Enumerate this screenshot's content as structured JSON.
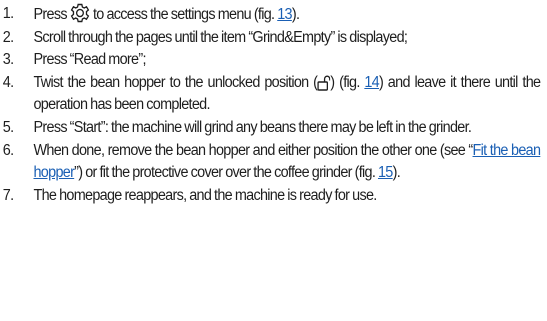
{
  "steps": [
    {
      "number": "1.",
      "before_icon": "Press ",
      "icon": "settings-gear-icon",
      "after_icon": " to access the settings menu (fig. ",
      "fig_link": "13",
      "end": ")."
    },
    {
      "number": "2.",
      "text": "Scroll through the pages until the item “Grind&Empty” is displayed;"
    },
    {
      "number": "3.",
      "text": "Press “Read more”;"
    },
    {
      "number": "4.",
      "before_icon": "Twist the bean hopper to the unlocked position (",
      "icon": "unlocked-padlock-icon",
      "after_icon": ") (fig. ",
      "fig_link": "14",
      "end": ") and leave it there until the operation has been completed."
    },
    {
      "number": "5.",
      "text": "Press “Start”: the machine will grind any beans there may be left in the grinder."
    },
    {
      "number": "6.",
      "part1": "When done, remove the bean hopper and either position the other one (see “",
      "link_text": "Fit the bean hopper",
      "part2": "”) or fit the protective cover over the coffee grinder (fig. ",
      "fig_link": "15",
      "end": ")."
    },
    {
      "number": "7.",
      "text": "The homepage reappears, and the machine is ready for use."
    }
  ],
  "colors": {
    "text": "#1e1e1e",
    "link": "#1a5fb4"
  }
}
